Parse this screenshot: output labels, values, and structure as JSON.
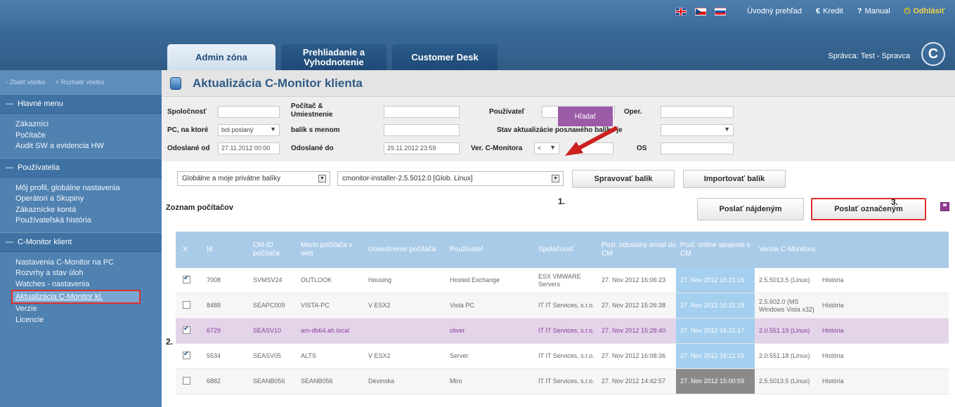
{
  "topbar": {
    "links": [
      {
        "icon": "",
        "label": "Úvodný prehľad"
      },
      {
        "icon": "€",
        "label": "Kredit"
      },
      {
        "icon": "?",
        "label": "Manual"
      },
      {
        "icon": "⏻",
        "label": "Odhlásiť"
      }
    ],
    "flags": [
      "flag-uk-icon",
      "flag-cz-icon",
      "flag-sk-icon"
    ],
    "manager": "Správca: Test - Spravca",
    "logo": "C"
  },
  "tabs": [
    "Admin zóna",
    "Prehliadanie a Vyhodnotenie",
    "Customer Desk"
  ],
  "sidebar": {
    "collapse_all": "Zbaliť všetko",
    "expand_all": "Rozbaliť všetko",
    "sections": [
      {
        "title": "Hlavné menu",
        "items": [
          "Zákazníci",
          "Počítače",
          "Audit SW a evidencia HW"
        ]
      },
      {
        "title": "Používatelia",
        "items": [
          "Môj profil, globálne nastavenia",
          "Operátori a Skupiny",
          "Zákaznícke kontá",
          "Používateľská história"
        ]
      },
      {
        "title": "C-Monitor klient",
        "items": [
          "Nastavenia C-Monitor na PC",
          "Rozvrhy a stav úloh",
          "Watches - nastavenia",
          "Aktualizácia C-Monitor kl.",
          "Verzie",
          "Licencie"
        ]
      }
    ]
  },
  "page": {
    "title": "Aktualizácia C-Monitor klienta"
  },
  "filters": {
    "company_label": "Spoločnosť",
    "computer_label": "Počítač & Umiestnenie",
    "user_label": "Používateľ",
    "oper_label": "Oper.",
    "pc_label": "PC, na ktoré",
    "pc_value": "bol poslaný",
    "package_name_label": "balík s menom",
    "state_label": "Stav aktualizácie posланého balíka je",
    "sent_from_label": "Odoslané od",
    "sent_from_value": "27.11.2012 00:00",
    "sent_to_label": "Odoslané do",
    "sent_to_value": "29.11.2012 23:59",
    "version_label": "Ver. C-Monitora",
    "version_op": "<",
    "os_label": "OS",
    "search_label": "Hľadať"
  },
  "packages": {
    "scope": "Globálne a moje privátne balíky",
    "selected": "cmonitor-installer-2.5.5012.0 [Glob. Linux]",
    "manage_label": "Spravovať balík",
    "import_label": "Importovať balík"
  },
  "list": {
    "title": "Zoznam počítačov",
    "send_found_label": "Poslať nájdeným",
    "send_marked_label": "Poslať označeným"
  },
  "annotations": {
    "one": "1.",
    "two": "2.",
    "three": "3."
  },
  "table": {
    "headers": [
      "X",
      "Id",
      "CM-ID počítača",
      "Meno počítača v sieti",
      "Umiestnenie počítača",
      "Používateľ",
      "Spoločnosť",
      "Posl. odoslaný email do CM",
      "Posl. online spojenie s CM",
      "Verzia C-Monitora",
      ""
    ],
    "rows": [
      {
        "checked": true,
        "id": "7008",
        "cmid": "SVMSV24",
        "name": "OUTLOOK",
        "location": "Housing",
        "user": "Hosted Exchange",
        "company": "ESX VMWARE Servers",
        "email": "27. Nov 2012 16:06:23",
        "online": "27. Nov 2012 16:21:16",
        "version": "2.5.5013.5 (Linux)",
        "history": "História"
      },
      {
        "checked": false,
        "id": "8488",
        "cmid": "SEAPC009",
        "name": "VISTA-PC",
        "location": "V ESX2",
        "user": "Vista PC",
        "company": "IT IT Services, s.r.o.",
        "email": "27. Nov 2012 15:26:38",
        "online": "27. Nov 2012 16:21:18",
        "version": "2.5.602.0 (MS Windows Vista x32)",
        "history": "História"
      },
      {
        "checked": true,
        "id": "6729",
        "cmid": "SEASV10",
        "name": "am-db64.ah.local",
        "location": "",
        "user": "oliver",
        "company": "IT IT Services, s.r.o.",
        "email": "27. Nov 2012 15:28:40",
        "online": "27. Nov 2012 16:21:17",
        "version": "2.0.551.19 (Linux)",
        "history": "História"
      },
      {
        "checked": true,
        "id": "5534",
        "cmid": "SEASV05",
        "name": "ALTS",
        "location": "V ESX2",
        "user": "Server",
        "company": "IT IT Services, s.r.o.",
        "email": "27. Nov 2012 16:08:36",
        "online": "27. Nov 2012 16:21:15",
        "version": "2.0.551.18 (Linux)",
        "history": "História"
      },
      {
        "checked": false,
        "id": "6882",
        "cmid": "SEANB056",
        "name": "SEANB056",
        "location": "Devinska",
        "user": "Miro",
        "company": "IT IT Services, s.r.o.",
        "email": "27. Nov 2012 14:42:57",
        "online": "27. Nov 2012 15:00:59",
        "version": "2.5.5013.5 (Linux)",
        "history": "História"
      }
    ]
  }
}
